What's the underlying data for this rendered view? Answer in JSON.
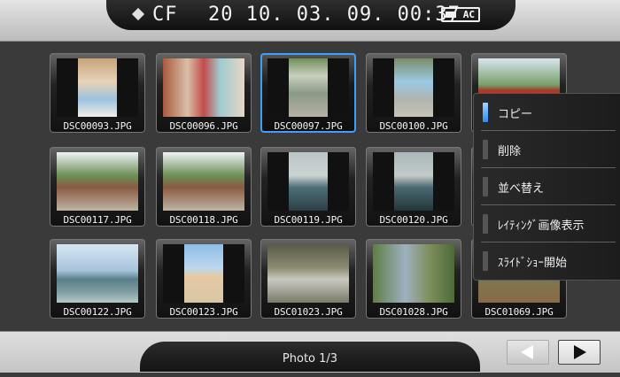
{
  "status": {
    "device": "CF",
    "datetime": "20 10. 03. 09. 00:37",
    "power": "AC",
    "power_icon": "ac-adapter-icon",
    "device_icon": "diamond-icon"
  },
  "thumbnails": [
    {
      "name": "DSC00093.JPG",
      "selected": false
    },
    {
      "name": "DSC00096.JPG",
      "selected": false
    },
    {
      "name": "DSC00097.JPG",
      "selected": true
    },
    {
      "name": "DSC00100.JPG",
      "selected": false
    },
    {
      "name": "",
      "selected": false
    },
    {
      "name": "DSC00117.JPG",
      "selected": false
    },
    {
      "name": "DSC00118.JPG",
      "selected": false
    },
    {
      "name": "DSC00119.JPG",
      "selected": false
    },
    {
      "name": "DSC00120.JPG",
      "selected": false
    },
    {
      "name": "",
      "selected": false
    },
    {
      "name": "DSC00122.JPG",
      "selected": false
    },
    {
      "name": "DSC00123.JPG",
      "selected": false
    },
    {
      "name": "DSC01023.JPG",
      "selected": false
    },
    {
      "name": "DSC01028.JPG",
      "selected": false
    },
    {
      "name": "DSC01069.JPG",
      "selected": false
    }
  ],
  "menu": {
    "items": [
      {
        "label": "コピー",
        "active": true
      },
      {
        "label": "削除",
        "active": false
      },
      {
        "label": "並べ替え",
        "active": false
      },
      {
        "label": "ﾚｲﾃｨﾝｸﾞ画像表示",
        "active": false
      },
      {
        "label": "ｽﾗｲﾄﾞｼｮｰ開始",
        "active": false
      }
    ]
  },
  "footer": {
    "page": "Photo 1/3",
    "prev_icon": "left-arrow-icon",
    "next_icon": "right-arrow-icon"
  },
  "colors": {
    "selection": "#3da0ff",
    "background": "#3a3a3a"
  }
}
